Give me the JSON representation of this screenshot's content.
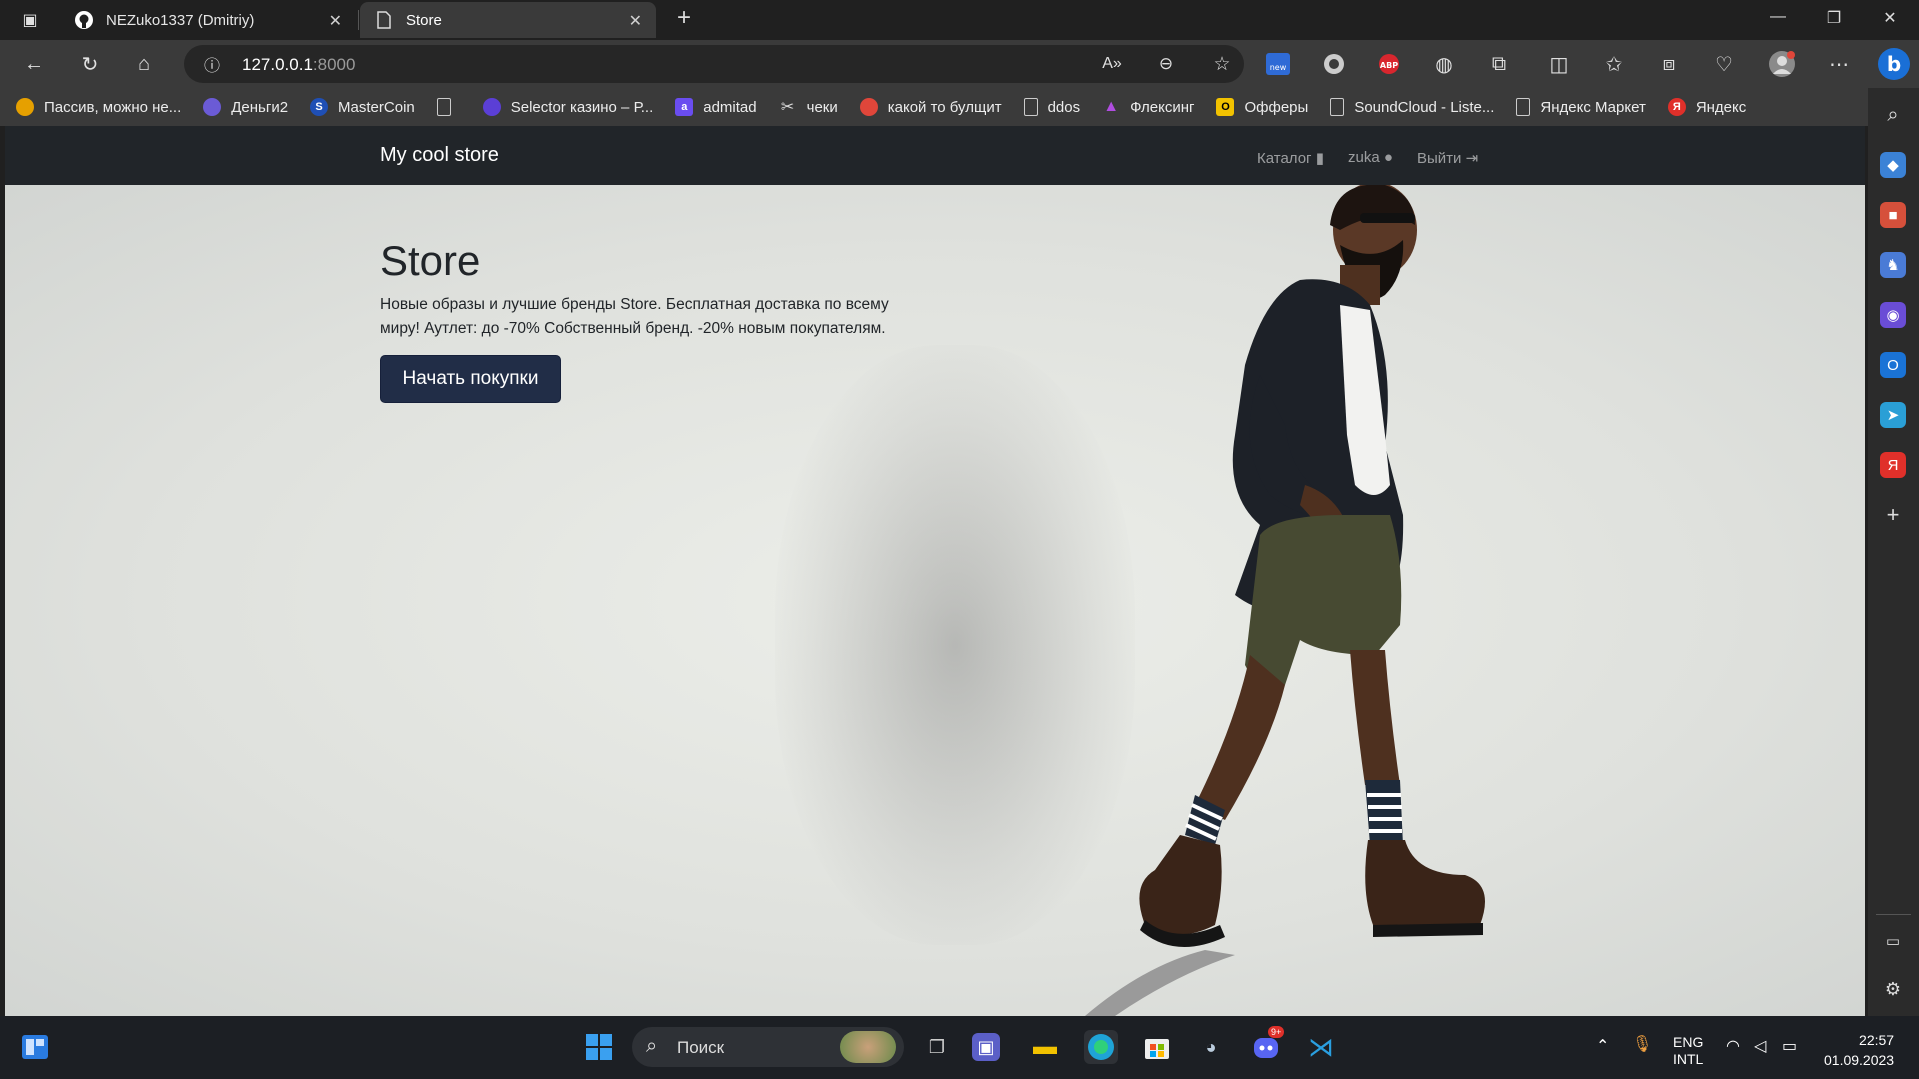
{
  "browser": {
    "tabs": [
      {
        "title": "NEZuko1337 (Dmitriy)",
        "icon": "github-icon"
      },
      {
        "title": "Store",
        "icon": "page-icon"
      }
    ],
    "url_host": "127.0.0.1",
    "url_port": ":8000"
  },
  "bookmarks": [
    {
      "label": "Пассив, можно не...",
      "color": "#e6a000"
    },
    {
      "label": "Деньги2",
      "color": "#6b5bd6"
    },
    {
      "label": "MasterCoin",
      "color": "#1f4fb5"
    },
    {
      "label": "",
      "color": "#3a3a3a"
    },
    {
      "label": "Selector казино – Р...",
      "color": "#5b3fd6"
    },
    {
      "label": "admitad",
      "color": "#6a4df0"
    },
    {
      "label": "чеки",
      "color": "#3a3a3a"
    },
    {
      "label": "какой то булщит",
      "color": "#e0463a"
    },
    {
      "label": "ddos",
      "color": "#3a3a3a"
    },
    {
      "label": "Флексинг",
      "color": "#8e3bd6"
    },
    {
      "label": "Офферы",
      "color": "#f2c200"
    },
    {
      "label": "SoundCloud - Liste...",
      "color": "#3a3a3a"
    },
    {
      "label": "Яндекс Маркет",
      "color": "#3a3a3a"
    },
    {
      "label": "Яндекс",
      "color": "#e0302a"
    }
  ],
  "site": {
    "brand": "My cool store",
    "nav": {
      "catalog": "Каталог",
      "user": "zuka",
      "logout": "Выйти"
    },
    "hero": {
      "title": "Store",
      "description": "Новые образы и лучшие бренды Store. Бесплатная доставка по всему миру! Аутлет: до -70% Собственный бренд. -20% новым покупателям.",
      "button": "Начать покупки"
    }
  },
  "taskbar": {
    "search_label": "Поиск",
    "lang_top": "ENG",
    "lang_bottom": "INTL",
    "time": "22:57",
    "date": "01.09.2023",
    "discord_badge": "9+"
  }
}
